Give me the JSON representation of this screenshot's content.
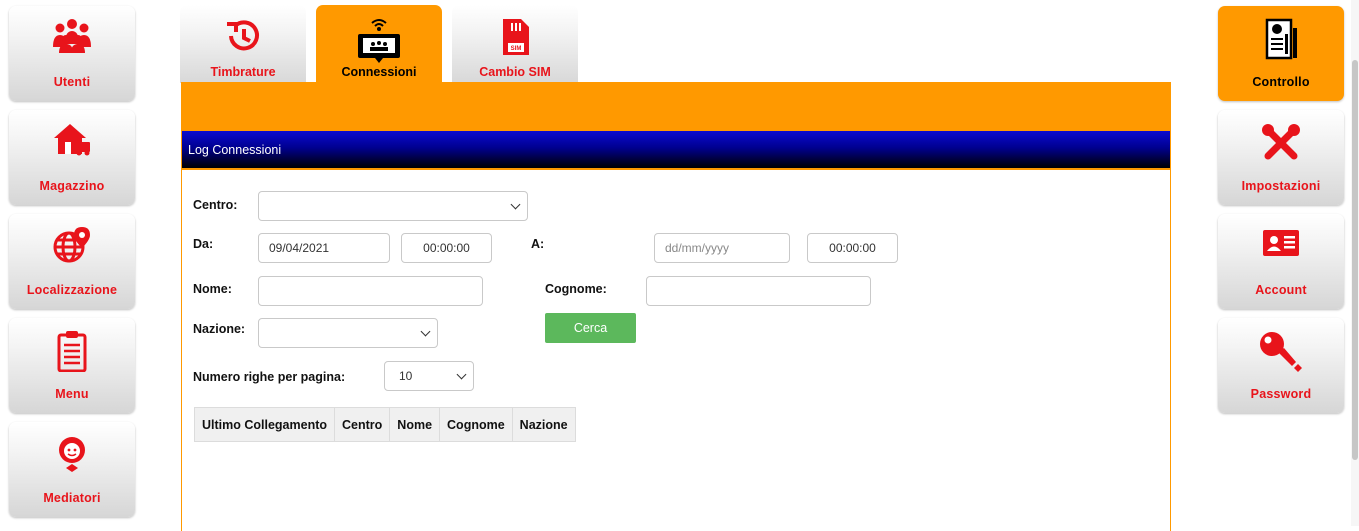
{
  "left_nav": [
    {
      "label": "Utenti",
      "icon": "users-icon"
    },
    {
      "label": "Magazzino",
      "icon": "warehouse-icon"
    },
    {
      "label": "Localizzazione",
      "icon": "globe-pin-icon"
    },
    {
      "label": "Menu",
      "icon": "clipboard-list-icon"
    },
    {
      "label": "Mediatori",
      "icon": "mediator-icon"
    }
  ],
  "right_nav": [
    {
      "label": "Controllo",
      "icon": "report-icon",
      "active": true
    },
    {
      "label": "Impostazioni",
      "icon": "tools-icon"
    },
    {
      "label": "Account",
      "icon": "id-card-icon"
    },
    {
      "label": "Password",
      "icon": "key-icon"
    }
  ],
  "tabs": [
    {
      "label": "Timbrature",
      "icon": "clock-history-icon"
    },
    {
      "label": "Connessioni",
      "icon": "wifi-screen-icon",
      "active": true
    },
    {
      "label": "Cambio SIM",
      "icon": "sim-card-icon"
    }
  ],
  "panel": {
    "title": "Log Connessioni"
  },
  "form": {
    "centro_label": "Centro:",
    "centro_value": "",
    "da_label": "Da:",
    "da_date": "09/04/2021",
    "da_time": "00:00:00",
    "a_label": "A:",
    "a_date_placeholder": "dd/mm/yyyy",
    "a_time": "00:00:00",
    "nome_label": "Nome:",
    "nome_value": "",
    "cognome_label": "Cognome:",
    "cognome_value": "",
    "nazione_label": "Nazione:",
    "nazione_value": "",
    "cerca_label": "Cerca",
    "righe_label": "Numero righe per pagina:",
    "righe_value": "10"
  },
  "table": {
    "columns": [
      "Ultimo Collegamento",
      "Centro",
      "Nome",
      "Cognome",
      "Nazione"
    ]
  },
  "colors": {
    "accent": "#ff9900",
    "label_red": "#e8141b",
    "header_blue": "#000090",
    "button_green": "#5cb85c"
  }
}
